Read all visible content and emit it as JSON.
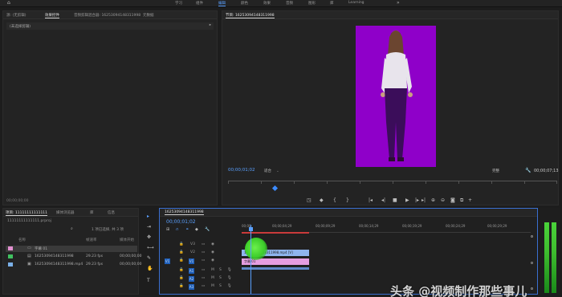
{
  "workspaces": {
    "home_icon": "home-icon",
    "items": [
      "学习",
      "组件",
      "编辑",
      "颜色",
      "效果",
      "音频",
      "图形",
      "库",
      "Learning"
    ],
    "active": "编辑",
    "more": "»"
  },
  "left_panel": {
    "tabs": [
      "源: (无剪辑)",
      "效果控件",
      "音频剪辑混合器: 16253094148311998",
      "元数据"
    ],
    "active_tab": "效果控件",
    "sub_label": "(未选择剪辑)",
    "sub_arrow": "▸",
    "timecode": "00;00;00;00"
  },
  "program": {
    "tab": "节目: 16253094148311998",
    "current_timecode": "00;00;01;02",
    "fit_label": "适合",
    "fit_dropdown": "⌄",
    "quality_label": "完整",
    "duration_timecode": "00;00;07;13",
    "background_color": "#8f00c9",
    "transport_icons": [
      "◳",
      "◆",
      "{",
      "}",
      "|◂",
      "◂|",
      "■",
      "▶",
      "|▸",
      "▸|",
      "⊕",
      "⊖",
      "◙",
      "⧉",
      "+"
    ]
  },
  "project": {
    "tabs": [
      "项目: 11111111111111",
      "媒体浏览器",
      "库",
      "信息"
    ],
    "active_tab": "项目: 11111111111111",
    "file_name": "11111111111111.prproj",
    "search_icon": "⌕",
    "selection_info": "1 项已选择, 共 3 项",
    "columns": {
      "name": "名称",
      "fps": "帧速率",
      "start": "媒体开始"
    },
    "rows": [
      {
        "name": "字幕 01",
        "fps": "",
        "start": "",
        "color": "#e28fd0",
        "selected": true
      },
      {
        "name": "16253094148311998",
        "fps": "29.23 fps",
        "start": "00;00;00;00",
        "color": "#40c060",
        "selected": false
      },
      {
        "name": "16253094148311998.mp4",
        "fps": "29.23 fps",
        "start": "00;00;00;00",
        "color": "#7ab0e8",
        "selected": false
      }
    ]
  },
  "tools": [
    "▸",
    "⇥",
    "✥",
    "⟷",
    "✎",
    "✋",
    "T"
  ],
  "timeline": {
    "tab": "16253094148311998",
    "timecode": "00;00;01;02",
    "ruler_labels": [
      "00;00",
      "00;00;04;29",
      "00;00;09;29",
      "00;00;14;29",
      "00;00;19;29",
      "00;00;24;29",
      "00;00;29;29",
      "00;00;34;28"
    ],
    "tracks": [
      {
        "id": "V3",
        "label": "V3"
      },
      {
        "id": "V2",
        "label": "V2"
      },
      {
        "id": "V1",
        "label": "V1"
      },
      {
        "id": "A1",
        "label": "A1"
      },
      {
        "id": "A2",
        "label": "A2"
      },
      {
        "id": "A3",
        "label": "A3"
      }
    ],
    "clips": [
      {
        "label": "16253094148311998.mp4 [V]",
        "color": "#8fb5ee"
      },
      {
        "label": "字幕 01",
        "color": "#e59de0"
      }
    ]
  },
  "watermark": "头条 @视频制作那些事儿"
}
